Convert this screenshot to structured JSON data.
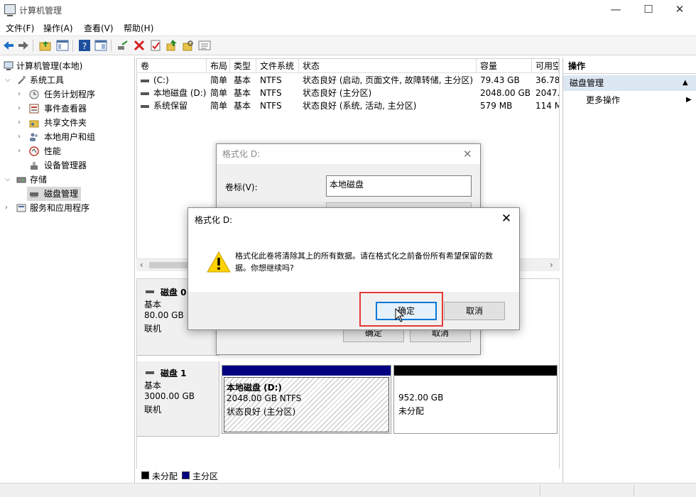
{
  "window": {
    "title": "计算机管理",
    "minimize": "—",
    "maximize": "☐",
    "close": "✕"
  },
  "menu": [
    "文件(F)",
    "操作(A)",
    "查看(V)",
    "帮助(H)"
  ],
  "toolbar_icons": [
    "back-icon",
    "forward-icon",
    "up-folder-icon",
    "show-hide-tree-icon",
    "help-icon",
    "console-icon",
    "connect-icon",
    "delete-icon",
    "properties-icon",
    "export-icon",
    "find-icon",
    "list-icon"
  ],
  "tree": {
    "root": "计算机管理(本地)",
    "items": [
      {
        "label": "系统工具"
      },
      {
        "label": "任务计划程序"
      },
      {
        "label": "事件查看器"
      },
      {
        "label": "共享文件夹"
      },
      {
        "label": "本地用户和组"
      },
      {
        "label": "性能"
      },
      {
        "label": "设备管理器"
      },
      {
        "label": "存储"
      },
      {
        "label": "磁盘管理"
      },
      {
        "label": "服务和应用程序"
      }
    ]
  },
  "volumes": {
    "headers": [
      "卷",
      "布局",
      "类型",
      "文件系统",
      "状态",
      "容量",
      "可用空"
    ],
    "rows": [
      [
        "(C:)",
        "简单",
        "基本",
        "NTFS",
        "状态良好 (启动, 页面文件, 故障转储, 主分区)",
        "79.43 GB",
        "36.78"
      ],
      [
        "本地磁盘 (D:)",
        "简单",
        "基本",
        "NTFS",
        "状态良好 (主分区)",
        "2048.00 GB",
        "2047.8"
      ],
      [
        "系统保留",
        "简单",
        "基本",
        "NTFS",
        "状态良好 (系统, 活动, 主分区)",
        "579 MB",
        "114 M"
      ]
    ]
  },
  "disks": [
    {
      "name": "磁盘 0",
      "type": "基本",
      "size": "80.00 GB",
      "status": "联机"
    },
    {
      "name": "磁盘 1",
      "type": "基本",
      "size": "3000.00 GB",
      "status": "联机",
      "partitions": [
        {
          "name": "本地磁盘  (D:)",
          "size_fs": "2048.00 GB NTFS",
          "status": "状态良好 (主分区)"
        },
        {
          "size": "952.00 GB",
          "status": "未分配"
        }
      ]
    }
  ],
  "legend": {
    "unallocated": "未分配",
    "primary": "主分区"
  },
  "colors": {
    "primary": "#000080",
    "unallocated": "#000000",
    "highlight": "#e53935",
    "selection": "#dce7f3"
  },
  "actions": {
    "header": "操作",
    "section": "磁盘管理",
    "more": "更多操作"
  },
  "format_dialog": {
    "title": "格式化 D:",
    "volume_label_caption": "卷标(V):",
    "volume_label_value": "本地磁盘",
    "ok": "确定",
    "cancel": "取消"
  },
  "confirm_dialog": {
    "title": "格式化 D:",
    "message": "格式化此卷将清除其上的所有数据。请在格式化之前备份所有希望保留的数据。你想继续吗?",
    "ok": "确定",
    "cancel": "取消"
  }
}
